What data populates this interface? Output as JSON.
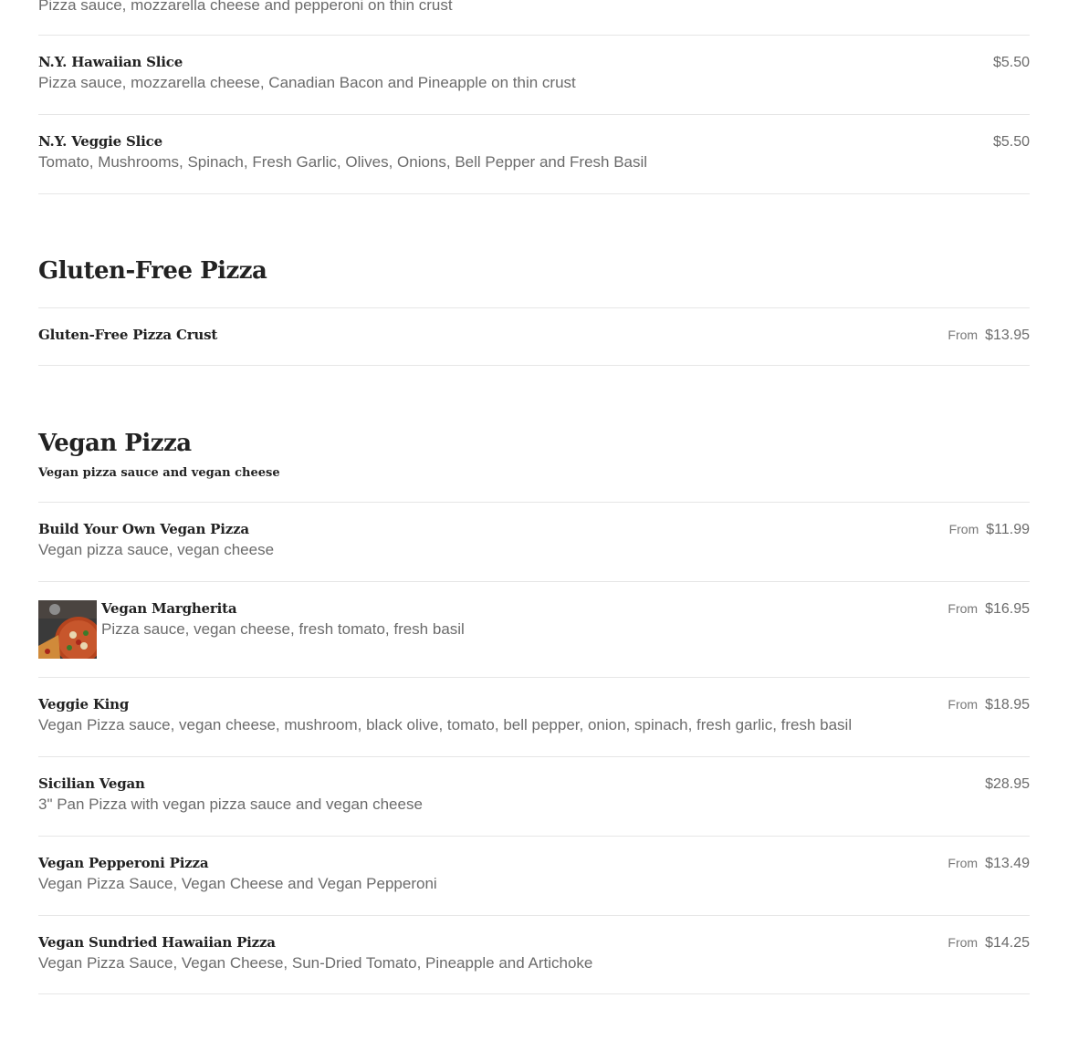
{
  "top_section": {
    "partial_desc": "Pizza sauce, mozzarella cheese and pepperoni on thin crust",
    "items": [
      {
        "name": "N.Y. Hawaiian Slice",
        "desc": "Pizza sauce, mozzarella cheese, Canadian Bacon and Pineapple on thin crust",
        "price": "$5.50"
      },
      {
        "name": "N.Y. Veggie Slice",
        "desc": "Tomato, Mushrooms, Spinach, Fresh Garlic, Olives, Onions, Bell Pepper and Fresh Basil",
        "price": "$5.50"
      }
    ]
  },
  "gluten_free": {
    "heading": "Gluten-Free Pizza",
    "items": [
      {
        "name": "Gluten-Free Pizza Crust",
        "from": "From",
        "price": "$13.95"
      }
    ]
  },
  "vegan": {
    "heading": "Vegan Pizza",
    "subheading": "Vegan pizza sauce and vegan cheese",
    "items": [
      {
        "name": "Build Your Own Vegan Pizza",
        "desc": "Vegan pizza sauce, vegan cheese",
        "from": "From",
        "price": "$11.99"
      },
      {
        "name": "Vegan Margherita",
        "desc": "Pizza sauce, vegan cheese, fresh tomato, fresh basil",
        "from": "From",
        "price": "$16.95"
      },
      {
        "name": "Veggie King",
        "desc": "Vegan Pizza sauce, vegan cheese, mushroom, black olive, tomato, bell pepper, onion, spinach, fresh garlic, fresh basil",
        "from": "From",
        "price": "$18.95"
      },
      {
        "name": "Sicilian Vegan",
        "desc": "3\" Pan Pizza with vegan pizza sauce and vegan cheese",
        "price": "$28.95"
      },
      {
        "name": "Vegan Pepperoni Pizza",
        "desc": "Vegan Pizza Sauce, Vegan Cheese and Vegan Pepperoni",
        "from": "From",
        "price": "$13.49"
      },
      {
        "name": "Vegan Sundried Hawaiian Pizza",
        "desc": "Vegan Pizza Sauce, Vegan Cheese, Sun-Dried Tomato, Pineapple and Artichoke",
        "from": "From",
        "price": "$14.25"
      }
    ]
  },
  "colors": {
    "heading": "#222222",
    "text": "#6b6b6b",
    "divider": "#e6e6e6"
  }
}
